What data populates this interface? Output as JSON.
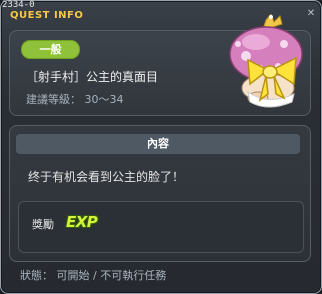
{
  "window": {
    "quest_id": "2334-0",
    "title": "QUEST INFO",
    "close_icon": "close-icon"
  },
  "quest": {
    "category": "一般",
    "name": "［射手村］公主的真面目",
    "level": "建議等級： 30～34"
  },
  "content": {
    "header": "內容",
    "text": "终于有机会看到公主的脸了！"
  },
  "reward": {
    "label": "獎勵",
    "exp_text": "EXP"
  },
  "status": {
    "text": "狀態： 可開始 / 不可執行任務"
  },
  "colors": {
    "title": "#f5c84a",
    "category_pill": "#8fc23a",
    "exp": "#d6f23c"
  }
}
